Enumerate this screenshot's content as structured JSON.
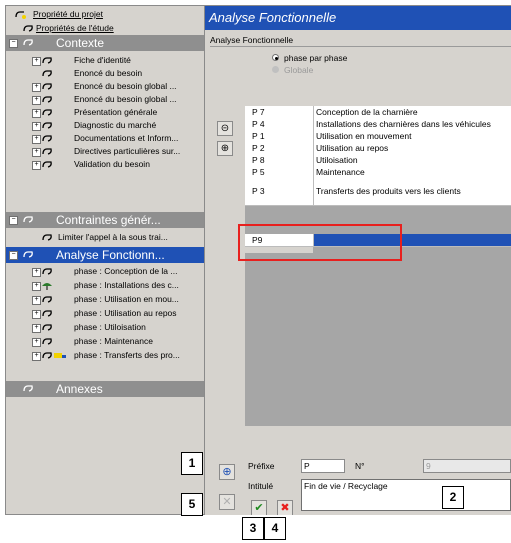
{
  "tree": {
    "top_items": [
      {
        "label": "Propriété du projet"
      },
      {
        "label": "Propriétés de l'étude"
      }
    ],
    "sections": [
      {
        "label": "Contexte",
        "items": [
          "Fiche d'identité",
          "Enoncé du besoin",
          "Enoncé du besoin global ...",
          "Enoncé du besoin global ...",
          "Présentation générale",
          "Diagnostic du marché",
          "Documentations et Inform...",
          "Directives particulières sur...",
          "Validation du besoin"
        ]
      },
      {
        "label": "Contraintes génér...",
        "items": [
          "Limiter l'appel à la sous trai..."
        ]
      },
      {
        "label": "Analyse Fonctionn...",
        "items": [
          "phase : Conception de la ...",
          "phase : Installations des c...",
          "phase : Utilisation en mou...",
          "phase : Utilisation au repos",
          "phase : Utiloisation",
          "phase : Maintenance",
          "phase : Transferts des pro..."
        ]
      },
      {
        "label": "Annexes",
        "items": []
      }
    ]
  },
  "main": {
    "title": "Analyse Fonctionnelle",
    "group_label": "Analyse Fonctionnelle",
    "radio_phase": "phase par phase",
    "radio_global": "Globale",
    "rows": [
      {
        "code": "P 7",
        "name": "Conception de la charnière"
      },
      {
        "code": "P 4",
        "name": "Installations des charnières dans les véhicules"
      },
      {
        "code": "P 1",
        "name": "Utilisation en mouvement"
      },
      {
        "code": "P 2",
        "name": "Utilisation au repos"
      },
      {
        "code": "P 8",
        "name": "Utiloisation"
      },
      {
        "code": "P 5",
        "name": "Maintenance"
      },
      {
        "code": "P 3",
        "name": "Transferts des produits vers les clients"
      },
      {
        "code": "P9",
        "name": ""
      }
    ],
    "form": {
      "prefix_label": "Préfixe",
      "prefix_value": "P",
      "num_label": "N°",
      "num_value": "9",
      "intitule_label": "Intitulé",
      "intitule_value": "Fin de vie / Recyclage"
    },
    "callouts": [
      "1",
      "2",
      "3",
      "4",
      "5"
    ],
    "colors": {
      "accent": "#1f51b5",
      "highlight_red": "#e8201e",
      "panel": "#d6d3ce"
    }
  }
}
